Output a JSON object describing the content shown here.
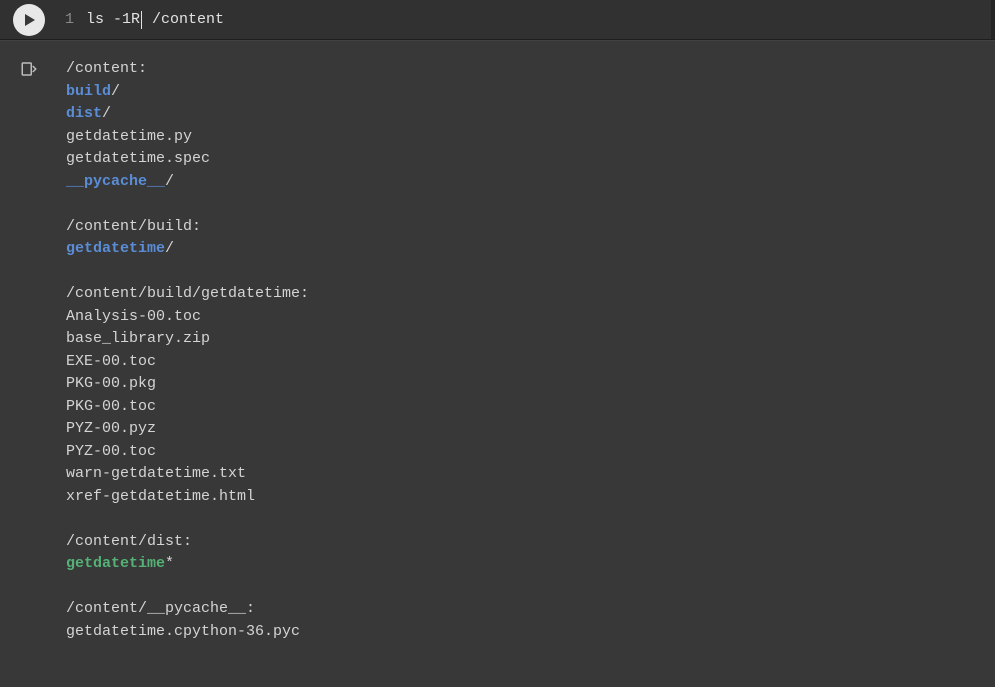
{
  "input": {
    "line_number": "1",
    "command_before_cursor": "ls -1R",
    "command_after_cursor": " /content"
  },
  "output": {
    "blocks": [
      {
        "header": "/content:",
        "items": [
          {
            "name": "build",
            "suffix": "/",
            "cls": "dir"
          },
          {
            "name": "dist",
            "suffix": "/",
            "cls": "dir"
          },
          {
            "name": "getdatetime.py",
            "suffix": "",
            "cls": "plain"
          },
          {
            "name": "getdatetime.spec",
            "suffix": "",
            "cls": "plain"
          },
          {
            "name": "__pycache__",
            "suffix": "/",
            "cls": "dir"
          }
        ]
      },
      {
        "header": "/content/build:",
        "items": [
          {
            "name": "getdatetime",
            "suffix": "/",
            "cls": "dir"
          }
        ]
      },
      {
        "header": "/content/build/getdatetime:",
        "items": [
          {
            "name": "Analysis-00.toc",
            "suffix": "",
            "cls": "plain"
          },
          {
            "name": "base_library.zip",
            "suffix": "",
            "cls": "plain"
          },
          {
            "name": "EXE-00.toc",
            "suffix": "",
            "cls": "plain"
          },
          {
            "name": "PKG-00.pkg",
            "suffix": "",
            "cls": "plain"
          },
          {
            "name": "PKG-00.toc",
            "suffix": "",
            "cls": "plain"
          },
          {
            "name": "PYZ-00.pyz",
            "suffix": "",
            "cls": "plain"
          },
          {
            "name": "PYZ-00.toc",
            "suffix": "",
            "cls": "plain"
          },
          {
            "name": "warn-getdatetime.txt",
            "suffix": "",
            "cls": "plain"
          },
          {
            "name": "xref-getdatetime.html",
            "suffix": "",
            "cls": "plain"
          }
        ]
      },
      {
        "header": "/content/dist:",
        "items": [
          {
            "name": "getdatetime",
            "suffix": "*",
            "cls": "exec"
          }
        ]
      },
      {
        "header": "/content/__pycache__:",
        "items": [
          {
            "name": "getdatetime.cpython-36.pyc",
            "suffix": "",
            "cls": "plain"
          }
        ]
      }
    ]
  }
}
